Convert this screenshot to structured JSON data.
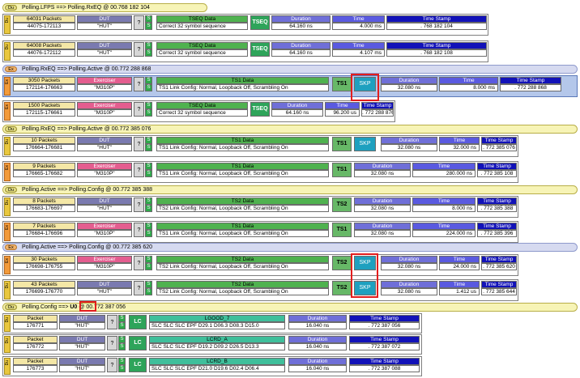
{
  "transitions": {
    "t1": {
      "tag": "Du",
      "text": "Polling.LFPS ==> Polling.RxEQ @ 00.768 182 104"
    },
    "t2": {
      "tag": "Ex",
      "text": "Polling.RxEQ ==> Polling.Active @ 00.772 288 868"
    },
    "t3": {
      "tag": "Du",
      "text": "Polling.RxEQ ==> Polling.Active @ 00.772 385 076"
    },
    "t4": {
      "tag": "Du",
      "text": "Polling.Active ==> Polling.Config @ 00.772 385 388"
    },
    "t5": {
      "tag": "Ex",
      "text": "Polling.Active ==> Polling.Config @ 00.772 385 620"
    },
    "t6": {
      "tag": "Du",
      "pre": "Polling.Config ==>",
      "u0": "U0",
      "post": "@ 00.772 387 056"
    }
  },
  "headers": {
    "dut": "DUT",
    "exerciser": "Exerciser",
    "tseq_data": "TSEQ Data",
    "ts1_data": "TS1 Data",
    "ts2_data": "TS2 Data",
    "duration": "Duration",
    "time": "Time",
    "time_stamp": "Time Stamp",
    "q": "?",
    "s": "S",
    "tseq": "TSEQ",
    "ts1": "TS1",
    "ts2": "TS2",
    "skp": "SKP",
    "lc": "LC",
    "packet": "Packet"
  },
  "rows": {
    "r1": {
      "dir": "Du",
      "count": "64031 Packets",
      "range": "44075-172113",
      "dev": "\"HUT\"",
      "data": "Correct 32 symbol sequence",
      "duration": "64.160 ns",
      "time": "4.000 ms",
      "stamp": ". 768 182 104"
    },
    "r2": {
      "dir": "Du",
      "count": "64008 Packets",
      "range": "44076-172112",
      "dev": "\"HUT\"",
      "data": "Correct 32 symbol sequence",
      "duration": "64.160 ns",
      "time": "4.107 ms",
      "stamp": ". 768 182 108"
    },
    "r3": {
      "dir": "Ex",
      "count": "3050 Packets",
      "range": "172114-176663",
      "dev": "\"M310P\"",
      "data": "TS1 Link Config: Normal, Loopback Off, Scrambling On",
      "duration": "32.080 ns",
      "time": "8.000 ms",
      "stamp": ". 772 288 868"
    },
    "r4": {
      "dir": "Ex",
      "count": "1500 Packets",
      "range": "172115-176661",
      "dev": "\"M310P\"",
      "data": "Correct 32 symbol sequence",
      "duration": "64.160 ns",
      "time": "96.200 us",
      "stamp": ". 772 288 876"
    },
    "r5": {
      "dir": "Du",
      "count": "10 Packets",
      "range": "176664-176681",
      "dev": "\"HUT\"",
      "data": "TS1 Link Config: Normal, Loopback Off, Scrambling On",
      "duration": "32.080 ns",
      "time": "32.000 ns",
      "stamp": ". 772 385 076"
    },
    "r6": {
      "dir": "Ex",
      "count": "9 Packets",
      "range": "176665-176682",
      "dev": "\"M310P\"",
      "data": "TS1 Link Config: Normal, Loopback Off, Scrambling On",
      "duration": "32.080 ns",
      "time": "280.000 ns",
      "stamp": ". 772 385 108"
    },
    "r7": {
      "dir": "Du",
      "count": "8 Packets",
      "range": "176683-176697",
      "dev": "\"HUT\"",
      "data": "TS2 Link Config: Normal, Loopback Off, Scrambling On",
      "duration": "32.080 ns",
      "time": "8.000 ns",
      "stamp": ". 772 385 388"
    },
    "r8": {
      "dir": "Ex",
      "count": "7 Packets",
      "range": "176684-176696",
      "dev": "\"M310P\"",
      "data": "TS1 Link Config: Normal, Loopback Off, Scrambling On",
      "duration": "32.080 ns",
      "time": "224.000 ns",
      "stamp": ". 772 385 396"
    },
    "r9": {
      "dir": "Ex",
      "count": "30 Packets",
      "range": "176698-176755",
      "dev": "\"M310P\"",
      "data": "TS2 Link Config: Normal, Loopback Off, Scrambling On",
      "duration": "32.080 ns",
      "time": "24.000 ns",
      "stamp": ". 772 385 620"
    },
    "r10": {
      "dir": "Du",
      "count": "43 Packets",
      "range": "176699-176770",
      "dev": "\"HUT\"",
      "data": "TS2 Link Config: Normal, Loopback Off, Scrambling On",
      "duration": "32.080 ns",
      "time": "1.412 us",
      "stamp": ". 772 385 644"
    },
    "r11": {
      "dir": "Du",
      "count": "Packet",
      "range": "176771",
      "dev": "\"HUT\"",
      "lname": "LGOOD_7",
      "data": "SLC SLC SLC EPF D29.1 D06.3 D08.3 D15.0",
      "duration": "16.040 ns",
      "stamp": ". 772 387 056"
    },
    "r12": {
      "dir": "Du",
      "count": "Packet",
      "range": "176772",
      "dev": "\"HUT\"",
      "lname": "LCRD_A",
      "data": "SLC SLC SLC EPF D19.2 D09.2 D26.5 D13.3",
      "duration": "16.040 ns",
      "stamp": ". 772 387 072"
    },
    "r13": {
      "dir": "Du",
      "count": "Packet",
      "range": "176773",
      "dev": "\"HUT\"",
      "lname": "LCRD_B",
      "data": "SLC SLC SLC EPF D21.0 D19.6 D02.4 D06.4",
      "duration": "16.040 ns",
      "stamp": ". 772 387 088"
    }
  }
}
